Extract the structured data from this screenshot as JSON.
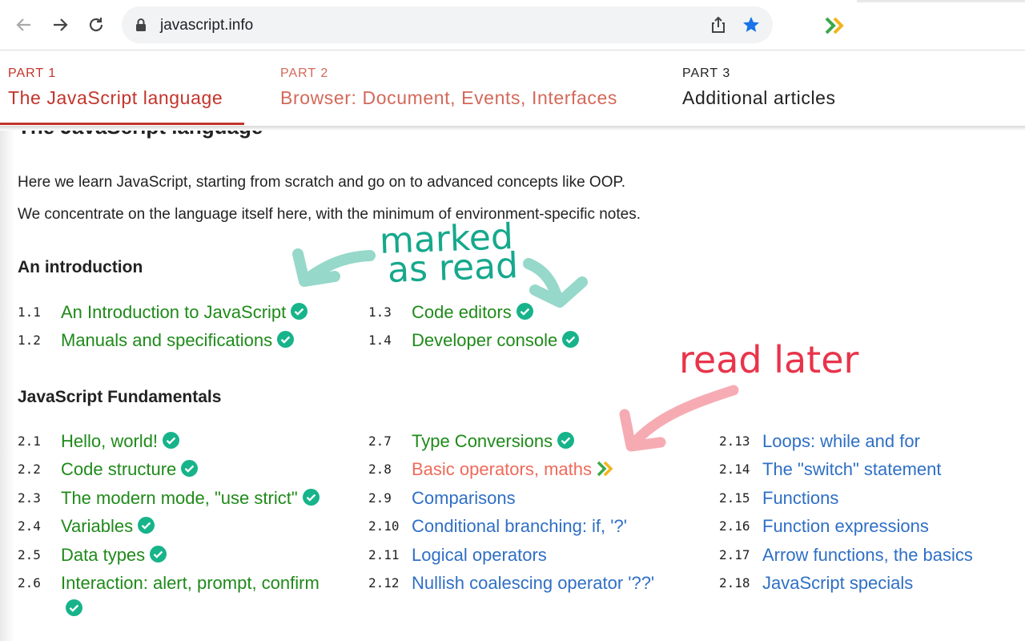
{
  "browser": {
    "url": "javascript.info"
  },
  "nav": {
    "part1": {
      "label": "PART 1",
      "title": "The JavaScript language"
    },
    "part2": {
      "label": "PART 2",
      "title": "Browser: Document, Events, Interfaces"
    },
    "part3": {
      "label": "PART 3",
      "title": "Additional articles"
    }
  },
  "content": {
    "title": "The JavaScript language",
    "intro1": "Here we learn JavaScript, starting from scratch and go on to advanced concepts like OOP.",
    "intro2": "We concentrate on the language itself here, with the minimum of environment-specific notes.",
    "section1": "An introduction",
    "section2": "JavaScript Fundamentals",
    "items": {
      "i11": {
        "num": "1.1",
        "title": "An Introduction to JavaScript"
      },
      "i12": {
        "num": "1.2",
        "title": "Manuals and specifications"
      },
      "i13": {
        "num": "1.3",
        "title": "Code editors"
      },
      "i14": {
        "num": "1.4",
        "title": "Developer console"
      },
      "i21": {
        "num": "2.1",
        "title": "Hello, world!"
      },
      "i22": {
        "num": "2.2",
        "title": "Code structure"
      },
      "i23": {
        "num": "2.3",
        "title": "The modern mode, \"use strict\""
      },
      "i24": {
        "num": "2.4",
        "title": "Variables"
      },
      "i25": {
        "num": "2.5",
        "title": "Data types"
      },
      "i26": {
        "num": "2.6",
        "title": "Interaction: alert, prompt, confirm"
      },
      "i27": {
        "num": "2.7",
        "title": "Type Conversions"
      },
      "i28": {
        "num": "2.8",
        "title": "Basic operators, maths"
      },
      "i29": {
        "num": "2.9",
        "title": "Comparisons"
      },
      "i210": {
        "num": "2.10",
        "title": "Conditional branching: if, '?'"
      },
      "i211": {
        "num": "2.11",
        "title": "Logical operators"
      },
      "i212": {
        "num": "2.12",
        "title": "Nullish coalescing operator '??'"
      },
      "i213": {
        "num": "2.13",
        "title": "Loops: while and for"
      },
      "i214": {
        "num": "2.14",
        "title": "The \"switch\" statement"
      },
      "i215": {
        "num": "2.15",
        "title": "Functions"
      },
      "i216": {
        "num": "2.16",
        "title": "Function expressions"
      },
      "i217": {
        "num": "2.17",
        "title": "Arrow functions, the basics"
      },
      "i218": {
        "num": "2.18",
        "title": "JavaScript specials"
      }
    }
  },
  "annotations": {
    "marked": "marked",
    "as_read": "as read",
    "read_later": "read later"
  },
  "colors": {
    "read_link": "#1f8a1a",
    "later_link": "#ef6a5a",
    "unread_link": "#2f6fc5",
    "check": "#17b38a",
    "accent": "#c2342b"
  },
  "icons": {
    "read": "check-circle-icon",
    "later": "double-chevron-icon"
  }
}
